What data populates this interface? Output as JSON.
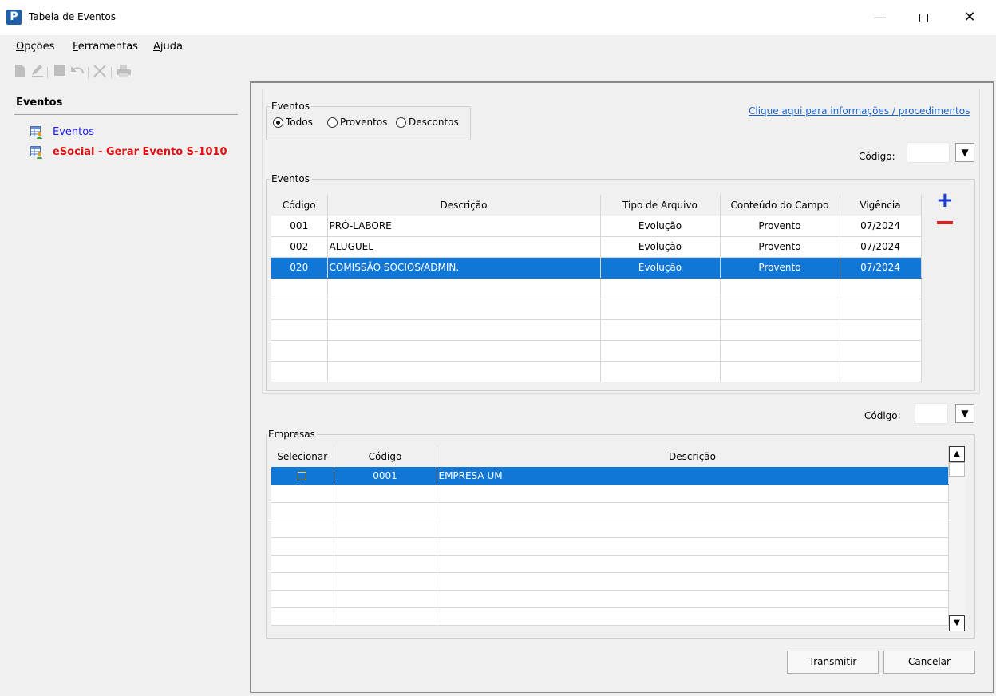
{
  "window": {
    "title": "Tabela de Eventos",
    "app_icon_letter": "P",
    "minimize": "—",
    "close": "✕"
  },
  "menu": {
    "opcoes": {
      "u": "O",
      "rest": "pções"
    },
    "ferramentas": {
      "u": "F",
      "rest": "erramentas"
    },
    "ajuda": {
      "u": "A",
      "rest": "juda"
    }
  },
  "toolbar_icons": [
    "new-document-icon",
    "edit-icon",
    "save-icon",
    "undo-icon",
    "delete-icon",
    "print-icon"
  ],
  "left_panel": {
    "header": "Eventos",
    "items": [
      "Eventos",
      "eSocial - Gerar Evento S-1010"
    ]
  },
  "filter": {
    "group_title": "Eventos",
    "options": [
      "Todos",
      "Proventos",
      "Descontos"
    ],
    "selected": "Todos",
    "info_link": "Clique aqui para informações / procedimentos",
    "codigo_label": "Código:"
  },
  "events_table": {
    "group_title": "Eventos",
    "columns": [
      "Código",
      "Descrição",
      "Tipo de Arquivo",
      "Conteúdo do Campo",
      "Vigência"
    ],
    "rows": [
      [
        "001",
        "PRÓ-LABORE",
        "Evolução",
        "Provento",
        "07/2024"
      ],
      [
        "002",
        "ALUGUEL",
        "Evolução",
        "Provento",
        "07/2024"
      ],
      [
        "020",
        "COMISSÃO SOCIOS/ADMIN.",
        "Evolução",
        "Provento",
        "07/2024"
      ]
    ],
    "selected_row": 2,
    "add_icon": "+",
    "remove_icon": "minus-icon"
  },
  "companies": {
    "codigo_label": "Código:",
    "group_title": "Empresas",
    "columns": [
      "Selecionar",
      "Código",
      "Descrição"
    ],
    "rows": [
      [
        "",
        "0001",
        "EMPRESA UM"
      ]
    ],
    "selected_row": 0
  },
  "buttons": {
    "transmit": "Transmitir",
    "cancel": "Cancelar"
  },
  "colors": {
    "selection": "#1077d6",
    "link": "#1e64c8",
    "esocial_red": "#e01010",
    "eventos_blue": "#1a1aff"
  }
}
